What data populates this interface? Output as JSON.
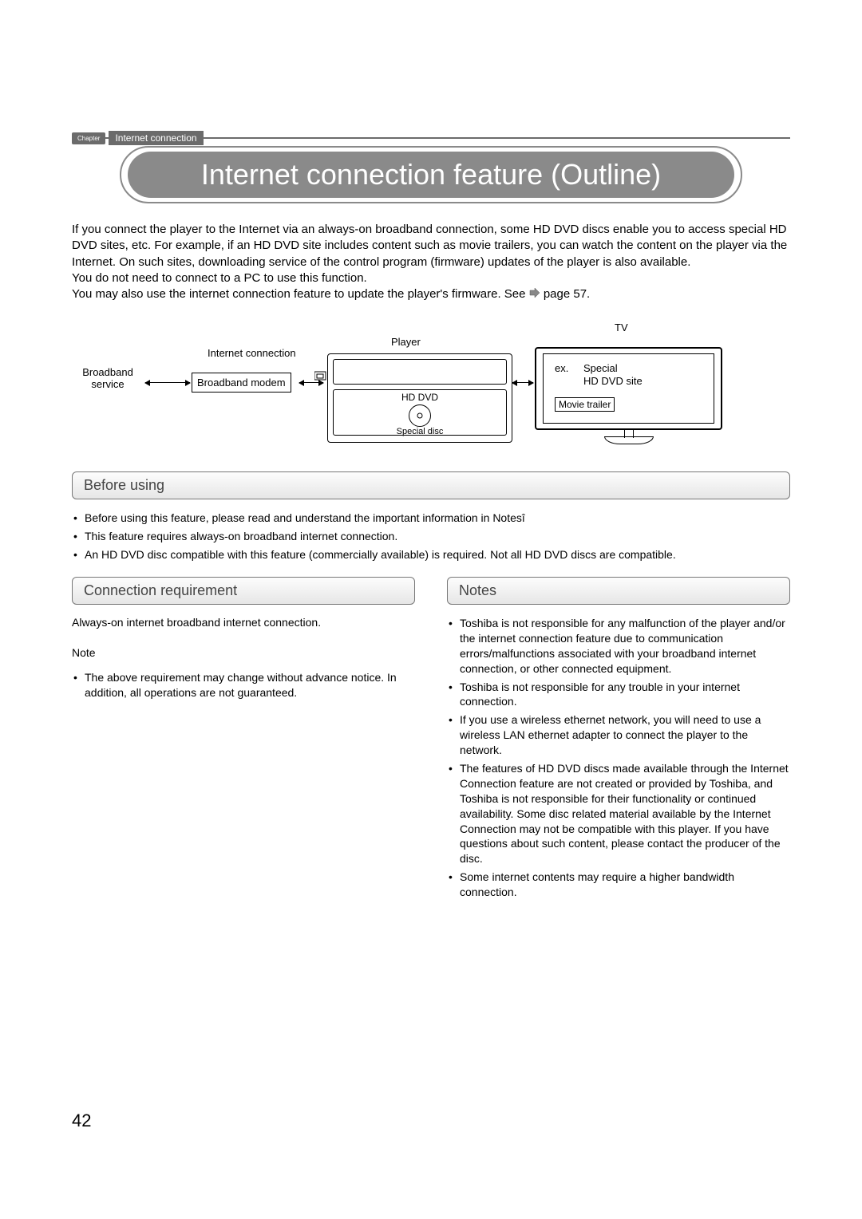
{
  "header": {
    "chapter": "Chapter",
    "section": "Internet connection"
  },
  "title": "Internet connection feature (Outline)",
  "intro": {
    "p1": "If you connect the player to the Internet via an always-on broadband connection, some HD DVD discs enable you to access special HD DVD sites, etc. For example, if an HD DVD site includes content such as movie trailers, you can watch the content on the player via the Internet. On such sites, downloading service of the control program (firmware) updates of the player is also available.",
    "p2": "You do not need to connect to a PC to use this function.",
    "p3a": "You may also use the internet connection feature to update the player's firmware. See ",
    "p3b": " page 57."
  },
  "diagram": {
    "broadband_service": "Broadband\nservice",
    "internet_connection": "Internet connection",
    "broadband_modem": "Broadband modem",
    "player": "Player",
    "hd_dvd": "HD DVD",
    "special_disc": "Special disc",
    "tv": "TV",
    "ex": "ex.",
    "special_site": "Special\nHD DVD site",
    "movie_trailer": "Movie trailer"
  },
  "before_using": {
    "heading": "Before using",
    "items": [
      "Before using this feature, please read and understand the important information in Notesî",
      "This feature requires always-on broadband internet connection.",
      "An HD DVD disc compatible with this feature (commercially available) is required. Not all HD DVD discs are compatible."
    ]
  },
  "connection_req": {
    "heading": "Connection requirement",
    "text": "Always-on internet broadband internet connection.",
    "note_heading": "Note",
    "note_items": [
      "The above requirement may change without advance notice. In addition, all operations are not guaranteed."
    ]
  },
  "notes": {
    "heading": "Notes",
    "items": [
      "Toshiba is not responsible for any malfunction of the player and/or the internet connection feature due to communication errors/malfunctions associated with your broadband internet connection, or other connected equipment.",
      "Toshiba is not responsible for any trouble in your internet connection.",
      "If you use a wireless ethernet network, you will need to use a wireless LAN ethernet adapter to connect the player to the network.",
      "The features of HD DVD discs made available through the Internet Connection feature are not created or provided by Toshiba, and Toshiba is not responsible for their functionality or continued availability. Some disc related material available by the Internet Connection may not be compatible with this player. If you have questions about such content, please contact the producer of the disc.",
      "Some internet contents may require a higher bandwidth connection."
    ]
  },
  "page_number": "42"
}
